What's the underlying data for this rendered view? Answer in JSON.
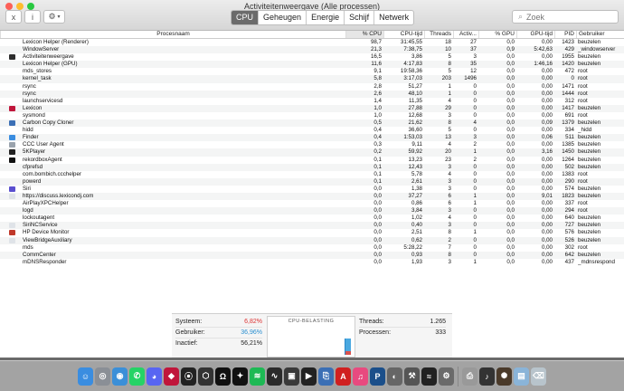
{
  "window": {
    "title": "Activiteitenweergave (Alle processen)"
  },
  "toolbar": {
    "close_icon": "x",
    "info_icon": "i",
    "gear_icon": "⚙",
    "tabs": [
      {
        "label": "CPU",
        "active": true
      },
      {
        "label": "Geheugen"
      },
      {
        "label": "Energie"
      },
      {
        "label": "Schijf"
      },
      {
        "label": "Netwerk"
      }
    ],
    "search_placeholder": "Zoek"
  },
  "table": {
    "columns": [
      "Procesnaam",
      "% CPU",
      "CPU-tijd",
      "Threads",
      "Activ...",
      "% GPU",
      "GPU-tijd",
      "PID",
      "Gebruiker"
    ],
    "rows": [
      {
        "name": "Lexicon Helper (Renderer)",
        "cpu": "98,7",
        "cputime": "31:45,55",
        "threads": "18",
        "activ": "27",
        "gpu": "0,0",
        "gputime": "0,00",
        "pid": "1423",
        "user": "beuzelen",
        "icon": ""
      },
      {
        "name": "WindowServer",
        "cpu": "21,3",
        "cputime": "7:38,75",
        "threads": "10",
        "activ": "37",
        "gpu": "0,9",
        "gputime": "5:42,63",
        "pid": "429",
        "user": "_windowserver",
        "icon": ""
      },
      {
        "name": "Activiteitenweergave",
        "cpu": "16,5",
        "cputime": "3,86",
        "threads": "5",
        "activ": "3",
        "gpu": "0,0",
        "gputime": "0,00",
        "pid": "1955",
        "user": "beuzelen",
        "icon": "#2d2d2d"
      },
      {
        "name": "Lexicon Helper (GPU)",
        "cpu": "11,6",
        "cputime": "4:17,83",
        "threads": "8",
        "activ": "35",
        "gpu": "0,0",
        "gputime": "1:46,16",
        "pid": "1420",
        "user": "beuzelen",
        "icon": ""
      },
      {
        "name": "mds_stores",
        "cpu": "9,1",
        "cputime": "19:58,36",
        "threads": "5",
        "activ": "12",
        "gpu": "0,0",
        "gputime": "0,00",
        "pid": "472",
        "user": "root",
        "icon": ""
      },
      {
        "name": "kernel_task",
        "cpu": "5,8",
        "cputime": "3:17,03",
        "threads": "203",
        "activ": "1496",
        "gpu": "0,0",
        "gputime": "0,00",
        "pid": "0",
        "user": "root",
        "icon": ""
      },
      {
        "name": "rsync",
        "cpu": "2,8",
        "cputime": "51,27",
        "threads": "1",
        "activ": "0",
        "gpu": "0,0",
        "gputime": "0,00",
        "pid": "1471",
        "user": "root",
        "icon": ""
      },
      {
        "name": "rsync",
        "cpu": "2,6",
        "cputime": "48,10",
        "threads": "1",
        "activ": "0",
        "gpu": "0,0",
        "gputime": "0,00",
        "pid": "1444",
        "user": "root",
        "icon": ""
      },
      {
        "name": "launchservicesd",
        "cpu": "1,4",
        "cputime": "11,35",
        "threads": "4",
        "activ": "0",
        "gpu": "0,0",
        "gputime": "0,00",
        "pid": "312",
        "user": "root",
        "icon": ""
      },
      {
        "name": "Lexicon",
        "cpu": "1,0",
        "cputime": "27,88",
        "threads": "29",
        "activ": "0",
        "gpu": "0,0",
        "gputime": "0,00",
        "pid": "1417",
        "user": "beuzelen",
        "icon": "#c0163b"
      },
      {
        "name": "sysmond",
        "cpu": "1,0",
        "cputime": "12,68",
        "threads": "3",
        "activ": "0",
        "gpu": "0,0",
        "gputime": "0,00",
        "pid": "691",
        "user": "root",
        "icon": ""
      },
      {
        "name": "Carbon Copy Cloner",
        "cpu": "0,5",
        "cputime": "21,62",
        "threads": "8",
        "activ": "4",
        "gpu": "0,0",
        "gputime": "0,09",
        "pid": "1379",
        "user": "beuzelen",
        "icon": "#3b6fb5"
      },
      {
        "name": "hidd",
        "cpu": "0,4",
        "cputime": "36,60",
        "threads": "5",
        "activ": "0",
        "gpu": "0,0",
        "gputime": "0,00",
        "pid": "334",
        "user": "_hidd",
        "icon": ""
      },
      {
        "name": "Finder",
        "cpu": "0,4",
        "cputime": "1:53,03",
        "threads": "13",
        "activ": "3",
        "gpu": "0,0",
        "gputime": "0,06",
        "pid": "511",
        "user": "beuzelen",
        "icon": "#3a8de0"
      },
      {
        "name": "CCC User Agent",
        "cpu": "0,3",
        "cputime": "9,11",
        "threads": "4",
        "activ": "2",
        "gpu": "0,0",
        "gputime": "0,00",
        "pid": "1385",
        "user": "beuzelen",
        "icon": "#9aa3ad"
      },
      {
        "name": "5KPlayer",
        "cpu": "0,2",
        "cputime": "59,92",
        "threads": "20",
        "activ": "1",
        "gpu": "0,0",
        "gputime": "3,16",
        "pid": "1450",
        "user": "beuzelen",
        "icon": "#222222"
      },
      {
        "name": "rekordboxAgent",
        "cpu": "0,1",
        "cputime": "13,23",
        "threads": "23",
        "activ": "2",
        "gpu": "0,0",
        "gputime": "0,00",
        "pid": "1264",
        "user": "beuzelen",
        "icon": "#111111"
      },
      {
        "name": "cfprefsd",
        "cpu": "0,1",
        "cputime": "12,43",
        "threads": "3",
        "activ": "0",
        "gpu": "0,0",
        "gputime": "0,00",
        "pid": "502",
        "user": "beuzelen",
        "icon": ""
      },
      {
        "name": "com.bombich.ccchelper",
        "cpu": "0,1",
        "cputime": "5,78",
        "threads": "4",
        "activ": "0",
        "gpu": "0,0",
        "gputime": "0,00",
        "pid": "1383",
        "user": "root",
        "icon": ""
      },
      {
        "name": "powerd",
        "cpu": "0,1",
        "cputime": "2,61",
        "threads": "3",
        "activ": "0",
        "gpu": "0,0",
        "gputime": "0,00",
        "pid": "290",
        "user": "root",
        "icon": ""
      },
      {
        "name": "Siri",
        "cpu": "0,0",
        "cputime": "1,38",
        "threads": "3",
        "activ": "0",
        "gpu": "0,0",
        "gputime": "0,00",
        "pid": "574",
        "user": "beuzelen",
        "icon": "#5a4fcf"
      },
      {
        "name": "https://discuss.lexicondj.com",
        "cpu": "0,0",
        "cputime": "37,27",
        "threads": "6",
        "activ": "1",
        "gpu": "0,0",
        "gputime": "9,01",
        "pid": "1823",
        "user": "beuzelen",
        "icon": "#dfe3e8"
      },
      {
        "name": "AirPlayXPCHelper",
        "cpu": "0,0",
        "cputime": "0,86",
        "threads": "6",
        "activ": "1",
        "gpu": "0,0",
        "gputime": "0,00",
        "pid": "337",
        "user": "root",
        "icon": ""
      },
      {
        "name": "logd",
        "cpu": "0,0",
        "cputime": "3,84",
        "threads": "3",
        "activ": "0",
        "gpu": "0,0",
        "gputime": "0,00",
        "pid": "294",
        "user": "root",
        "icon": ""
      },
      {
        "name": "lockoutagent",
        "cpu": "0,0",
        "cputime": "1,02",
        "threads": "4",
        "activ": "0",
        "gpu": "0,0",
        "gputime": "0,00",
        "pid": "640",
        "user": "beuzelen",
        "icon": ""
      },
      {
        "name": "SiriNCService",
        "cpu": "0,0",
        "cputime": "0,40",
        "threads": "3",
        "activ": "0",
        "gpu": "0,0",
        "gputime": "0,00",
        "pid": "727",
        "user": "beuzelen",
        "icon": "#dfe3e8"
      },
      {
        "name": "HP Device Monitor",
        "cpu": "0,0",
        "cputime": "2,51",
        "threads": "8",
        "activ": "1",
        "gpu": "0,0",
        "gputime": "0,00",
        "pid": "576",
        "user": "beuzelen",
        "icon": "#c0392b"
      },
      {
        "name": "ViewBridgeAuxiliary",
        "cpu": "0,0",
        "cputime": "0,62",
        "threads": "2",
        "activ": "0",
        "gpu": "0,0",
        "gputime": "0,00",
        "pid": "526",
        "user": "beuzelen",
        "icon": "#dfe3e8"
      },
      {
        "name": "mds",
        "cpu": "0,0",
        "cputime": "5:28,22",
        "threads": "7",
        "activ": "0",
        "gpu": "0,0",
        "gputime": "0,00",
        "pid": "302",
        "user": "root",
        "icon": ""
      },
      {
        "name": "CommCenter",
        "cpu": "0,0",
        "cputime": "0,93",
        "threads": "8",
        "activ": "0",
        "gpu": "0,0",
        "gputime": "0,00",
        "pid": "642",
        "user": "beuzelen",
        "icon": ""
      },
      {
        "name": "mDNSResponder",
        "cpu": "0,0",
        "cputime": "1,93",
        "threads": "3",
        "activ": "1",
        "gpu": "0,0",
        "gputime": "0,00",
        "pid": "437",
        "user": "_mdnsrespond",
        "icon": ""
      }
    ]
  },
  "summary": {
    "systeem_label": "Systeem:",
    "systeem_value": "6,82%",
    "systeem_color": "#d33",
    "gebruiker_label": "Gebruiker:",
    "gebruiker_value": "36,96%",
    "gebruiker_color": "#2a8fd0",
    "inactief_label": "Inactief:",
    "inactief_value": "56,21%",
    "graph_title": "CPU-BELASTING",
    "threads_label": "Threads:",
    "threads_value": "1.265",
    "processen_label": "Processen:",
    "processen_value": "333"
  },
  "dock": {
    "icons": [
      {
        "name": "finder-icon",
        "color": "#3a8de0",
        "glyph": "☺"
      },
      {
        "name": "launchpad-icon",
        "color": "#8a8f96",
        "glyph": "◎"
      },
      {
        "name": "safari-icon",
        "color": "#3b8fd8",
        "glyph": "◉"
      },
      {
        "name": "whatsapp-icon",
        "color": "#25d366",
        "glyph": "✆"
      },
      {
        "name": "discord-icon",
        "color": "#5865f2",
        "glyph": "◕"
      },
      {
        "name": "lexicon-icon",
        "color": "#c0163b",
        "glyph": "◆"
      },
      {
        "name": "rekordbox-icon",
        "color": "#222",
        "glyph": "⦿"
      },
      {
        "name": "tools-icon",
        "color": "#333",
        "glyph": "⬡"
      },
      {
        "name": "ableton-icon",
        "color": "#111",
        "glyph": "Ω"
      },
      {
        "name": "tidal-icon",
        "color": "#111",
        "glyph": "✦"
      },
      {
        "name": "spotify-icon",
        "color": "#1db954",
        "glyph": "≋"
      },
      {
        "name": "waveform-icon",
        "color": "#2b2b2b",
        "glyph": "∿"
      },
      {
        "name": "mixxx-icon",
        "color": "#3a3a3a",
        "glyph": "▣"
      },
      {
        "name": "5kplayer-icon",
        "color": "#222",
        "glyph": "▶"
      },
      {
        "name": "ccc-icon",
        "color": "#3b6fb5",
        "glyph": "⎘"
      },
      {
        "name": "akai-mpx-icon",
        "color": "#d02020",
        "glyph": "A"
      },
      {
        "name": "itunes-icon",
        "color": "#e84a7f",
        "glyph": "♫"
      },
      {
        "name": "photoshop-icon",
        "color": "#1b4f8a",
        "glyph": "P"
      },
      {
        "name": "reeder-icon",
        "color": "#666",
        "glyph": "◐"
      },
      {
        "name": "hammer-icon",
        "color": "#555",
        "glyph": "⚒"
      },
      {
        "name": "activity-monitor-icon",
        "color": "#222",
        "glyph": "≈"
      },
      {
        "name": "utilities-icon",
        "color": "#6a6a6a",
        "glyph": "⚙"
      },
      {
        "name": "printer-icon",
        "color": "#999",
        "glyph": "⎙"
      },
      {
        "name": "music-app-icon",
        "color": "#333",
        "glyph": "♪"
      },
      {
        "name": "gear-app-icon",
        "color": "#4a3a2a",
        "glyph": "✺"
      },
      {
        "name": "preview-icon",
        "color": "#8ab4d8",
        "glyph": "▤"
      },
      {
        "name": "trash-icon",
        "color": "#b8c4cc",
        "glyph": "⌫"
      }
    ]
  }
}
